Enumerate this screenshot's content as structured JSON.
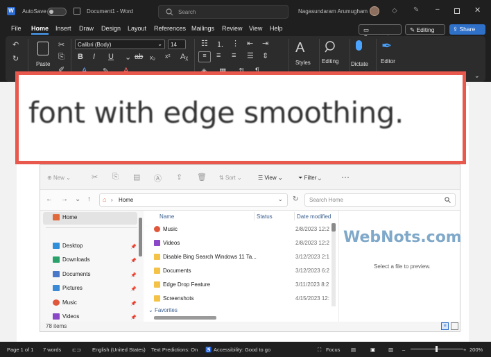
{
  "titlebar": {
    "autosave_label": "AutoSave",
    "doc_title": "Document1 - Word",
    "search_placeholder": "Search",
    "user_name": "Nagasundaram Arumugham"
  },
  "menu": {
    "items": [
      "File",
      "Home",
      "Insert",
      "Draw",
      "Design",
      "Layout",
      "References",
      "Mailings",
      "Review",
      "View",
      "Help"
    ],
    "active": "Home",
    "comments_label": "Comments",
    "editing_label": "Editing",
    "share_label": "Share"
  },
  "ribbon": {
    "paste_label": "Paste",
    "font_name": "Calibri (Body)",
    "font_size": "14",
    "styles_label": "Styles",
    "editing_label": "Editing",
    "dictate_label": "Dictate",
    "editor_label": "Editor"
  },
  "callout": {
    "text": "font with edge smoothing."
  },
  "explorer": {
    "toolbar": {
      "new_label": "New",
      "sort_label": "Sort",
      "view_label": "View",
      "filter_label": "Filter"
    },
    "address": "Home",
    "search_placeholder": "Search Home",
    "nav_items": [
      {
        "label": "Home",
        "color": "#e06a3b"
      },
      {
        "label": "Desktop",
        "color": "#2f8fd8"
      },
      {
        "label": "Downloads",
        "color": "#2aa06a"
      },
      {
        "label": "Documents",
        "color": "#4a78c8"
      },
      {
        "label": "Pictures",
        "color": "#3a8ad6"
      },
      {
        "label": "Music",
        "color": "#e0573b"
      },
      {
        "label": "Videos",
        "color": "#8a48c8"
      }
    ],
    "columns": {
      "name": "Name",
      "status": "Status",
      "date": "Date modified"
    },
    "files": [
      {
        "name": "Music",
        "date": "2/8/2023 12:2",
        "color": "#e0573b"
      },
      {
        "name": "Videos",
        "date": "2/8/2023 12:2",
        "color": "#8a48c8"
      },
      {
        "name": "Disable Bing Search Windows 11 Ta...",
        "date": "3/12/2023 2:1",
        "color": "#f3c246"
      },
      {
        "name": "Documents",
        "date": "3/12/2023 6:2",
        "color": "#f3c246"
      },
      {
        "name": "Edge Drop Feature",
        "date": "3/11/2023 8:2",
        "color": "#f3c246"
      },
      {
        "name": "Screenshots",
        "date": "4/15/2023 12:",
        "color": "#f3c246"
      }
    ],
    "group_label": "Favorites",
    "preview_text": "Select a file to preview.",
    "watermark": "WebNots.com",
    "status": "78 items"
  },
  "statusbar": {
    "page": "Page 1 of 1",
    "words": "7 words",
    "language": "English (United States)",
    "predictions": "Text Predictions: On",
    "accessibility": "Accessibility: Good to go",
    "focus": "Focus",
    "zoom": "200%"
  }
}
